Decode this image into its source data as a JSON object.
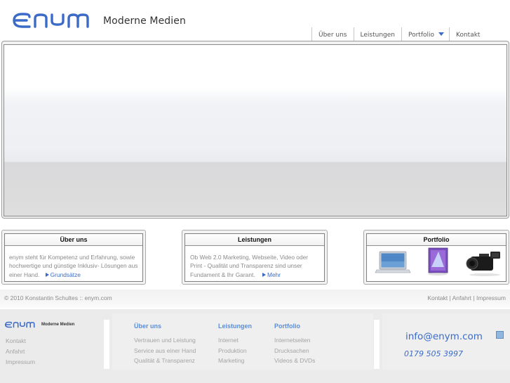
{
  "header": {
    "logo_text": "enym",
    "tagline": "Moderne Medien",
    "nav": [
      {
        "label": "Über uns"
      },
      {
        "label": "Leistungen"
      },
      {
        "label": "Portfolio",
        "has_dropdown": true
      },
      {
        "label": "Kontakt"
      }
    ]
  },
  "boxes": {
    "ueber": {
      "title": "Über uns",
      "text": "enym steht für Kompetenz und Erfahrung, sowie hochwertige und günstige Inklusiv- Lösungen aus einer Hand.",
      "more": "Grundsätze"
    },
    "leistungen": {
      "title": "Leistungen",
      "text": "Ob Web 2.0 Marketing, Webseite, Video oder Print - Qualität und Transparenz sind unser Fundament & Ihr Garant.",
      "more": "Mehr"
    },
    "portfolio": {
      "title": "Portfolio",
      "images": [
        "laptop-image",
        "dvd-case-image",
        "video-camera-image"
      ]
    }
  },
  "footer_bar": {
    "copyright": "© 2010 Konstantin Schultes :: enym.com",
    "legal": [
      "Kontakt",
      "Anfahrt",
      "Impressum"
    ],
    "legal_separator": " | "
  },
  "footer": {
    "logo_text": "enym",
    "tagline": "Moderne Medien",
    "links": [
      "Kontakt",
      "Anfahrt",
      "Impressum"
    ],
    "columns": [
      {
        "heading": "Über uns",
        "items": [
          "Vertrauen und Leistung",
          "Service aus einer Hand",
          "Qualität & Transparenz"
        ]
      },
      {
        "heading": "Leistungen",
        "items": [
          "Internet",
          "Produktion",
          "Marketing"
        ]
      },
      {
        "heading": "Portfolio",
        "items": [
          "Internetseiten",
          "Drucksachen",
          "Videos & DVDs"
        ]
      }
    ],
    "email": "info@enym.com",
    "phone": "0179 505 3997"
  },
  "colors": {
    "accent": "#3b6bc6",
    "footer_heading": "#5b8ed6"
  }
}
